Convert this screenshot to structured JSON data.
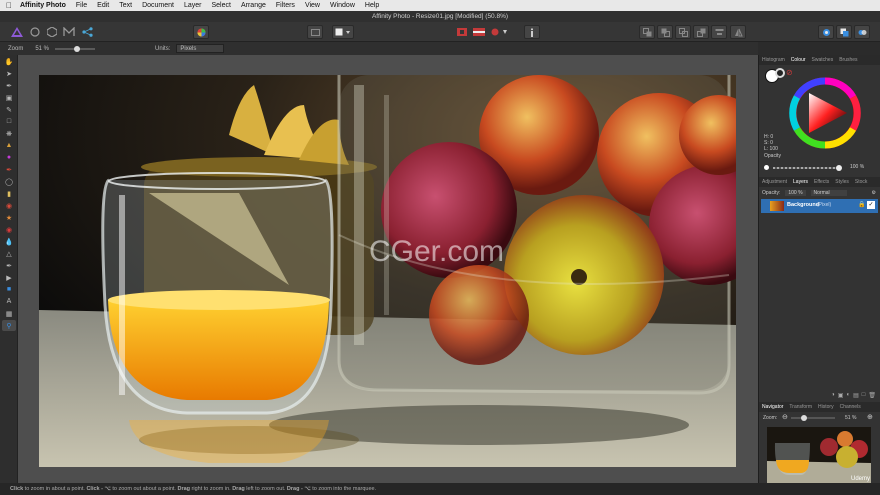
{
  "menubar": {
    "app_name": "Affinity Photo",
    "items": [
      "File",
      "Edit",
      "Text",
      "Document",
      "Layer",
      "Select",
      "Arrange",
      "Filters",
      "View",
      "Window",
      "Help"
    ]
  },
  "window": {
    "title": "Affinity Photo - Resize01.jpg [Modified] (50.8%)"
  },
  "context_toolbar": {
    "zoom_label": "Zoom",
    "zoom_value": "51 %",
    "units_label": "Units:",
    "units_value": "Pixels",
    "zoom_slider_fraction": 0.55
  },
  "colour_panel": {
    "tabs": [
      "Histogram",
      "Colour",
      "Swatches",
      "Brushes"
    ],
    "active_tab": "Colour",
    "h": "H: 0",
    "s": "S: 0",
    "l": "L: 100",
    "opacity_label": "Opacity",
    "opacity_value": "100 %",
    "opacity_fraction": 1.0
  },
  "layers_panel": {
    "tabs": [
      "Adjustment",
      "Layers",
      "Effects",
      "Styles",
      "Stock"
    ],
    "active_tab": "Layers",
    "opacity_label": "Opacity:",
    "opacity_value": "100 %",
    "blend_mode": "Normal",
    "layer_name": "Background",
    "layer_type": "(Pixel)"
  },
  "navigator_panel": {
    "tabs": [
      "Navigator",
      "Transform",
      "History",
      "Channels"
    ],
    "active_tab": "Navigator",
    "zoom_label": "Zoom:",
    "zoom_value": "51 %",
    "zoom_fraction": 0.3
  },
  "watermark": {
    "center_text": "CGer.com",
    "corner_text": "Udemy"
  },
  "statusbar": {
    "click_key": "Click",
    "click_text": " to zoom in about a point. ",
    "alt_click_key": "Click - ⌥",
    "alt_click_text": " to zoom out about a point. ",
    "drag_right_key": "Drag",
    "drag_right_text": " right to zoom in. ",
    "drag_left_key": "Drag",
    "drag_left_text": " left to zoom out. ",
    "drag_marquee_key": "Drag - ⌥",
    "drag_marquee_text": " to zoom into the marquee."
  },
  "colors": {
    "accent": "#2f6fb3",
    "panel_bg": "#333333",
    "canvas_bg": "#4e4e4e"
  }
}
